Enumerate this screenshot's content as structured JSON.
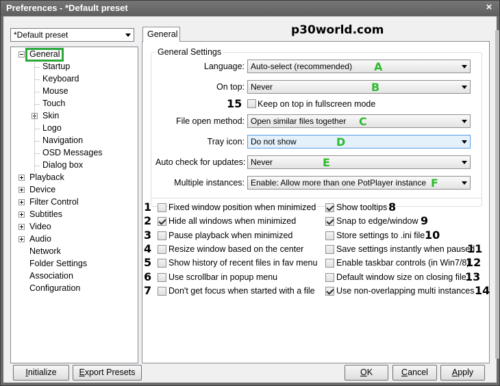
{
  "window": {
    "title": "Preferences - *Default preset",
    "close_glyph": "×"
  },
  "preset_combo": {
    "value": "*Default preset"
  },
  "watermark": "p30world.com",
  "tab": {
    "label": "General"
  },
  "tree": {
    "items": [
      {
        "label": "General",
        "selected": true
      },
      {
        "label": "Startup"
      },
      {
        "label": "Keyboard"
      },
      {
        "label": "Mouse"
      },
      {
        "label": "Touch"
      },
      {
        "label": "Skin",
        "expandable": true
      },
      {
        "label": "Logo"
      },
      {
        "label": "Navigation"
      },
      {
        "label": "OSD Messages"
      },
      {
        "label": "Dialog box"
      },
      {
        "label": "Playback",
        "expandable": true
      },
      {
        "label": "Device",
        "expandable": true
      },
      {
        "label": "Filter Control",
        "expandable": true
      },
      {
        "label": "Subtitles",
        "expandable": true
      },
      {
        "label": "Video",
        "expandable": true
      },
      {
        "label": "Audio",
        "expandable": true
      },
      {
        "label": "Network"
      },
      {
        "label": "Folder Settings"
      },
      {
        "label": "Association"
      },
      {
        "label": "Configuration"
      }
    ]
  },
  "general_settings": {
    "legend": "General Settings",
    "language": {
      "label": "Language:",
      "value": "Auto-select (recommended)",
      "marker": "A"
    },
    "on_top": {
      "label": "On top:",
      "value": "Never",
      "marker": "B"
    },
    "keep_on_top": {
      "label": "Keep on top in fullscreen mode",
      "checked": false,
      "marker": "15"
    },
    "file_open": {
      "label": "File open method:",
      "value": "Open similar files together",
      "marker": "C"
    },
    "tray_icon": {
      "label": "Tray icon:",
      "value": "Do not show",
      "marker": "D"
    },
    "auto_check": {
      "label": "Auto check for updates:",
      "value": "Never",
      "marker": "E"
    },
    "multiple": {
      "label": "Multiple instances:",
      "value": "Enable: Allow more than one PotPlayer instance",
      "marker": "F"
    }
  },
  "options_left": [
    {
      "marker": "1",
      "label": "Fixed window position when minimized",
      "checked": false
    },
    {
      "marker": "2",
      "label": "Hide all windows when minimized",
      "checked": true
    },
    {
      "marker": "3",
      "label": "Pause playback when minimized",
      "checked": false
    },
    {
      "marker": "4",
      "label": "Resize window based on the center",
      "checked": false
    },
    {
      "marker": "5",
      "label": "Show history of recent files in fav menu",
      "checked": false
    },
    {
      "marker": "6",
      "label": "Use scrollbar in popup menu",
      "checked": false
    },
    {
      "marker": "7",
      "label": "Don't get focus when started with a file",
      "checked": false
    }
  ],
  "options_right": [
    {
      "marker": "8",
      "label": "Show tooltips",
      "checked": true
    },
    {
      "marker": "9",
      "label": "Snap to edge/window",
      "checked": true
    },
    {
      "marker": "10",
      "label": "Store settings to .ini file",
      "checked": false
    },
    {
      "marker": "11",
      "label": "Save settings instantly when paused",
      "checked": false
    },
    {
      "marker": "12",
      "label": "Enable taskbar controls (in Win7/8)",
      "checked": false
    },
    {
      "marker": "13",
      "label": "Default window size on closing file",
      "checked": false
    },
    {
      "marker": "14",
      "label": "Use non-overlapping multi instances",
      "checked": true
    }
  ],
  "buttons": {
    "initialize": {
      "hot": "I",
      "rest": "nitialize"
    },
    "export": {
      "hot": "E",
      "rest": "xport Presets"
    },
    "ok": {
      "hot": "O",
      "rest": "K"
    },
    "cancel": {
      "hot": "C",
      "rest": "ancel"
    },
    "apply": {
      "hot": "A",
      "rest": "pply"
    }
  }
}
